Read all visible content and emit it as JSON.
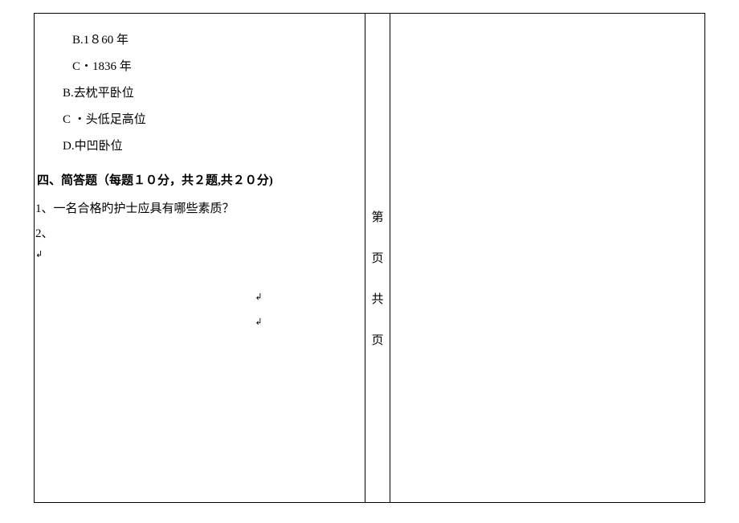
{
  "options": {
    "b1": "B.1８60 年",
    "c1": "C・1836 年",
    "b2": "B.去枕平卧位",
    "c2": "C ・头低足高位",
    "d": "D.中凹卧位"
  },
  "section4": {
    "title": "四、简答题（每题１０分，共２题,共２０分)",
    "q1": "1、一名合格旳护士应具有哪些素质？",
    "q2": "2、"
  },
  "sidebar": {
    "char1": "第",
    "char2": "页",
    "char3": "共",
    "char4": "页"
  },
  "markers": {
    "m1": "↲",
    "m2": "↲",
    "m3": "↲"
  }
}
